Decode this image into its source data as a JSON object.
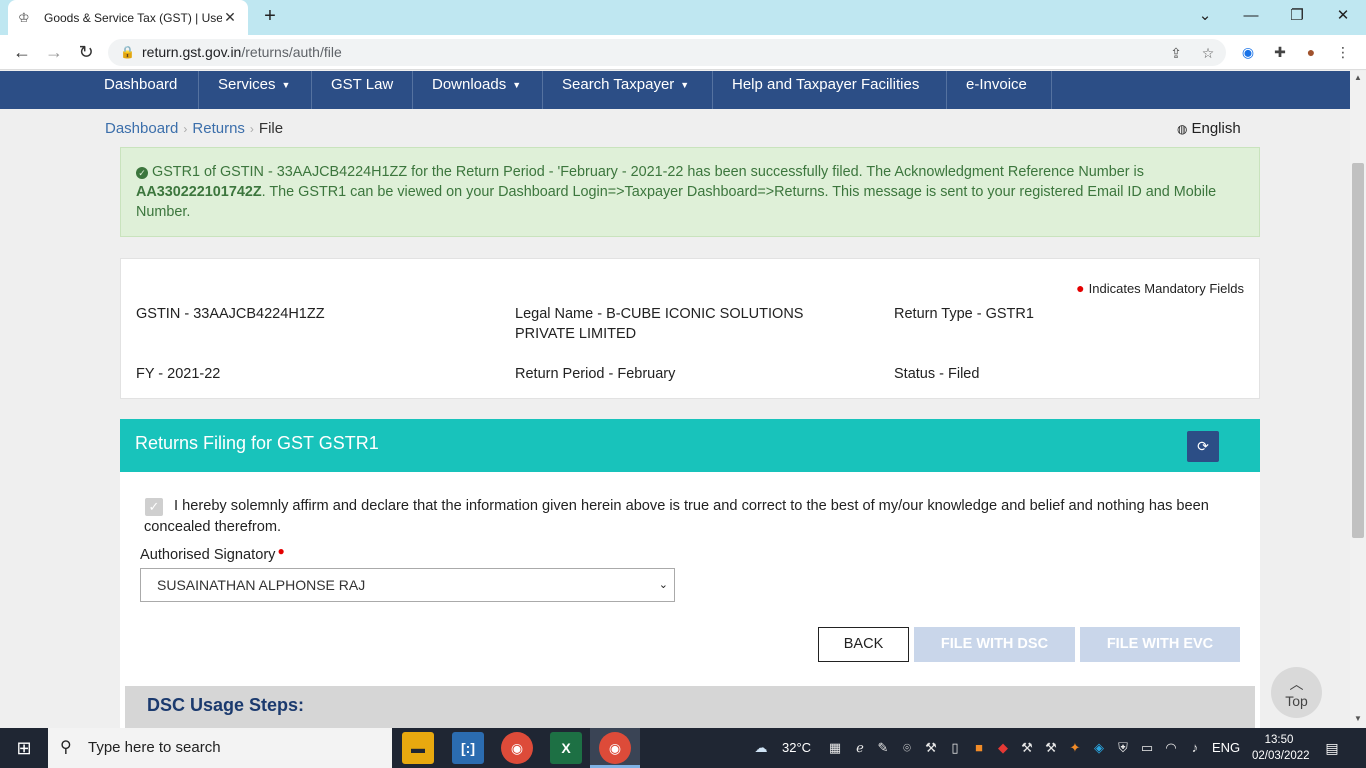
{
  "browser": {
    "tab_title": "Goods & Service Tax (GST) | User",
    "url_host": "return.gst.gov.in",
    "url_path": "/returns/auth/file"
  },
  "nav": {
    "items": [
      {
        "label": "Dashboard",
        "dropdown": false
      },
      {
        "label": "Services",
        "dropdown": true
      },
      {
        "label": "GST Law",
        "dropdown": false
      },
      {
        "label": "Downloads",
        "dropdown": true
      },
      {
        "label": "Search Taxpayer",
        "dropdown": true
      },
      {
        "label": "Help and Taxpayer Facilities",
        "dropdown": false
      },
      {
        "label": "e-Invoice",
        "dropdown": false
      }
    ]
  },
  "breadcrumb": {
    "items": [
      "Dashboard",
      "Returns",
      "File"
    ]
  },
  "language": "English",
  "alert": {
    "text_before": "GSTR1 of GSTIN - 33AAJCB4224H1ZZ for the Return Period - 'February - 2021-22 has been successfully filed. The Acknowledgment Reference Number is ",
    "ack_number": "AA330222101742Z",
    "text_after": ". The GSTR1 can be viewed on your Dashboard Login=>Taxpayer Dashboard=>Returns. This message is sent to your registered Email ID and Mobile Number."
  },
  "info": {
    "mandatory_note": "Indicates Mandatory Fields",
    "gstin": "GSTIN - 33AAJCB4224H1ZZ",
    "legal_name": "Legal Name - B-CUBE ICONIC SOLUTIONS PRIVATE LIMITED",
    "return_type": "Return Type - GSTR1",
    "fy": "FY - 2021-22",
    "return_period": "Return Period - February",
    "status": "Status - Filed"
  },
  "filing": {
    "title": "Returns Filing for GST GSTR1",
    "declaration": "I hereby solemnly affirm and declare that the information given herein above is true and correct to the best of my/our knowledge and belief and nothing has been concealed therefrom.",
    "declaration_checked": true,
    "signatory_label": "Authorised Signatory",
    "signatory_value": "SUSAINATHAN ALPHONSE RAJ",
    "buttons": {
      "back": "BACK",
      "dsc": "FILE WITH DSC",
      "evc": "FILE WITH EVC"
    }
  },
  "dsc_steps": {
    "title": "DSC Usage Steps:"
  },
  "top_button": "Top",
  "taskbar": {
    "search_placeholder": "Type here to search",
    "weather": "32°C",
    "lang": "ENG",
    "time": "13:50",
    "date": "02/03/2022"
  },
  "colors": {
    "navbar": "#2c4e86",
    "filing_header": "#18c3bb",
    "alert_bg": "#dff0d8",
    "alert_text": "#3c763d",
    "disabled_button": "#c9d6ea"
  }
}
